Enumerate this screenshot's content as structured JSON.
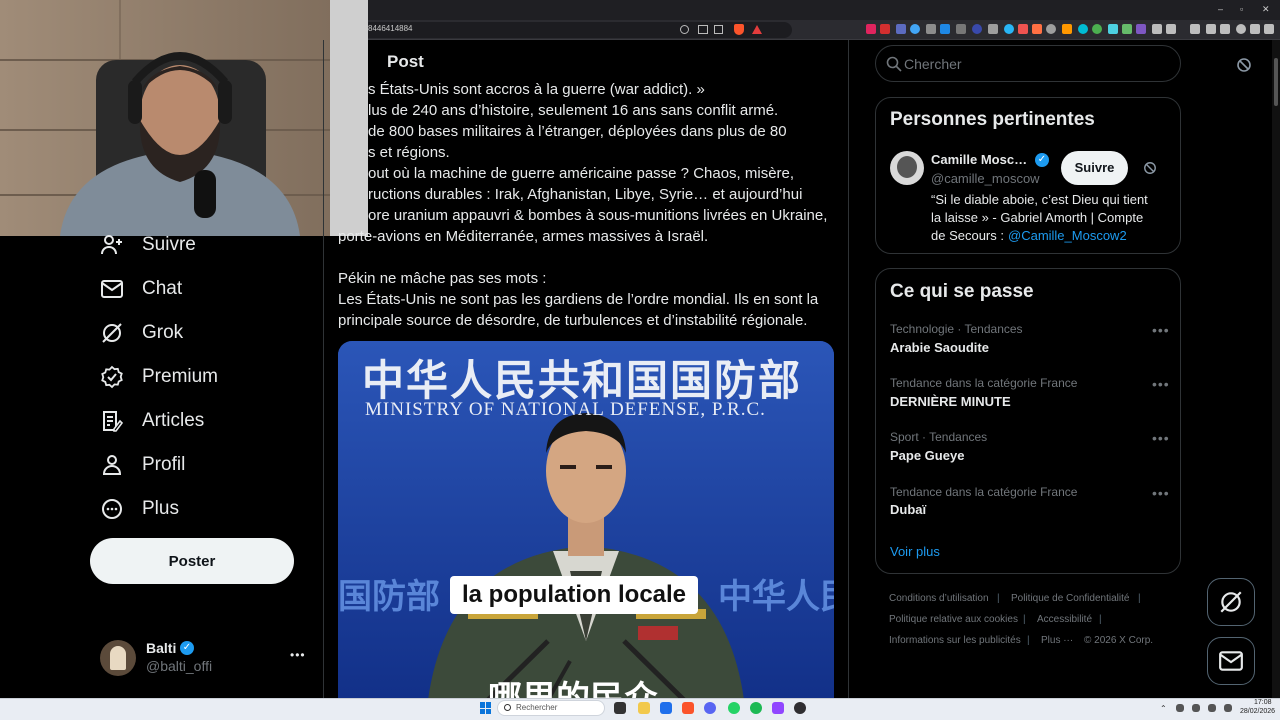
{
  "browser": {
    "url": "8446414884",
    "window_controls": [
      "–",
      "▫",
      "✕"
    ]
  },
  "nav": {
    "items": [
      {
        "label": "Suivre",
        "icon": "add-user-icon"
      },
      {
        "label": "Chat",
        "icon": "mail-icon"
      },
      {
        "label": "Grok",
        "icon": "grok-icon"
      },
      {
        "label": "Premium",
        "icon": "verified-icon"
      },
      {
        "label": "Articles",
        "icon": "article-icon"
      },
      {
        "label": "Profil",
        "icon": "person-icon"
      },
      {
        "label": "Plus",
        "icon": "more-circle-icon"
      }
    ],
    "post_button": "Poster",
    "account": {
      "name": "Balti",
      "handle": "@balti_offi",
      "menu": "•••"
    }
  },
  "post": {
    "header": "Post",
    "lines": [
      "s États-Unis sont accros à la guerre (war addict). »",
      "lus de 240 ans d’histoire, seulement 16 ans sans conflit armé.",
      "de 800 bases militaires à l’étranger, déployées dans plus de 80",
      "s et régions.",
      "out où la machine de guerre américaine passe ? Chaos, misère,",
      "ructions durables : Irak, Afghanistan, Libye, Syrie… et aujourd’hui",
      "ore uranium appauvri & bombes à sous-munitions livrées en Ukraine,",
      "porte-avions en Méditerranée, armes massives à Israël.",
      "Pékin ne mâche pas ses mots :",
      "Les États-Unis ne sont pas les gardiens de l’ordre mondial. Ils en sont la",
      "principale source de désordre, de turbulences et d’instabilité régionale."
    ],
    "video": {
      "banner_cn": "中华人民共和国国防部",
      "banner_en": "MINISTRY OF NATIONAL DEFENSE, P.R.C.",
      "backdrop_left_cn": "国防部",
      "backdrop_right_cn": "中华人民",
      "subtitle": "la population locale",
      "subtitle_cn_partial": "哪里的民众"
    }
  },
  "sidebar": {
    "search_placeholder": "Chercher",
    "people": {
      "title": "Personnes pertinentes",
      "person": {
        "name": "Camille Mosc…",
        "handle": "@camille_moscow",
        "follow": "Suivre",
        "bio_1": "“Si le diable aboie, c’est Dieu qui tient",
        "bio_2": "la laisse » - Gabriel Amorth | Compte",
        "bio_3": "de Secours :",
        "bio_link": "@Camille_Moscow2"
      }
    },
    "trends": {
      "title": "Ce qui se passe",
      "items": [
        {
          "meta": "Technologie · Tendances",
          "name": "Arabie Saoudite"
        },
        {
          "meta": "Tendance dans la catégorie France",
          "name": "DERNIÈRE MINUTE"
        },
        {
          "meta": "Sport · Tendances",
          "name": "Pape Gueye"
        },
        {
          "meta": "Tendance dans la catégorie France",
          "name": "Dubaï"
        }
      ],
      "more_dots": "•••",
      "show_more": "Voir plus"
    },
    "footer": {
      "terms": "Conditions d’utilisation",
      "privacy": "Politique de Confidentialité",
      "cookies": "Politique relative aux cookies",
      "accessibility": "Accessibilité",
      "ads": "Informations sur les publicités",
      "more": "Plus ···",
      "copyright": "© 2026 X Corp."
    }
  },
  "taskbar": {
    "search": "Rechercher",
    "time": "17:08",
    "date": "28/02/2026"
  },
  "colors": {
    "accent": "#1d9bf0",
    "background": "#000000",
    "muted": "#71767b"
  }
}
